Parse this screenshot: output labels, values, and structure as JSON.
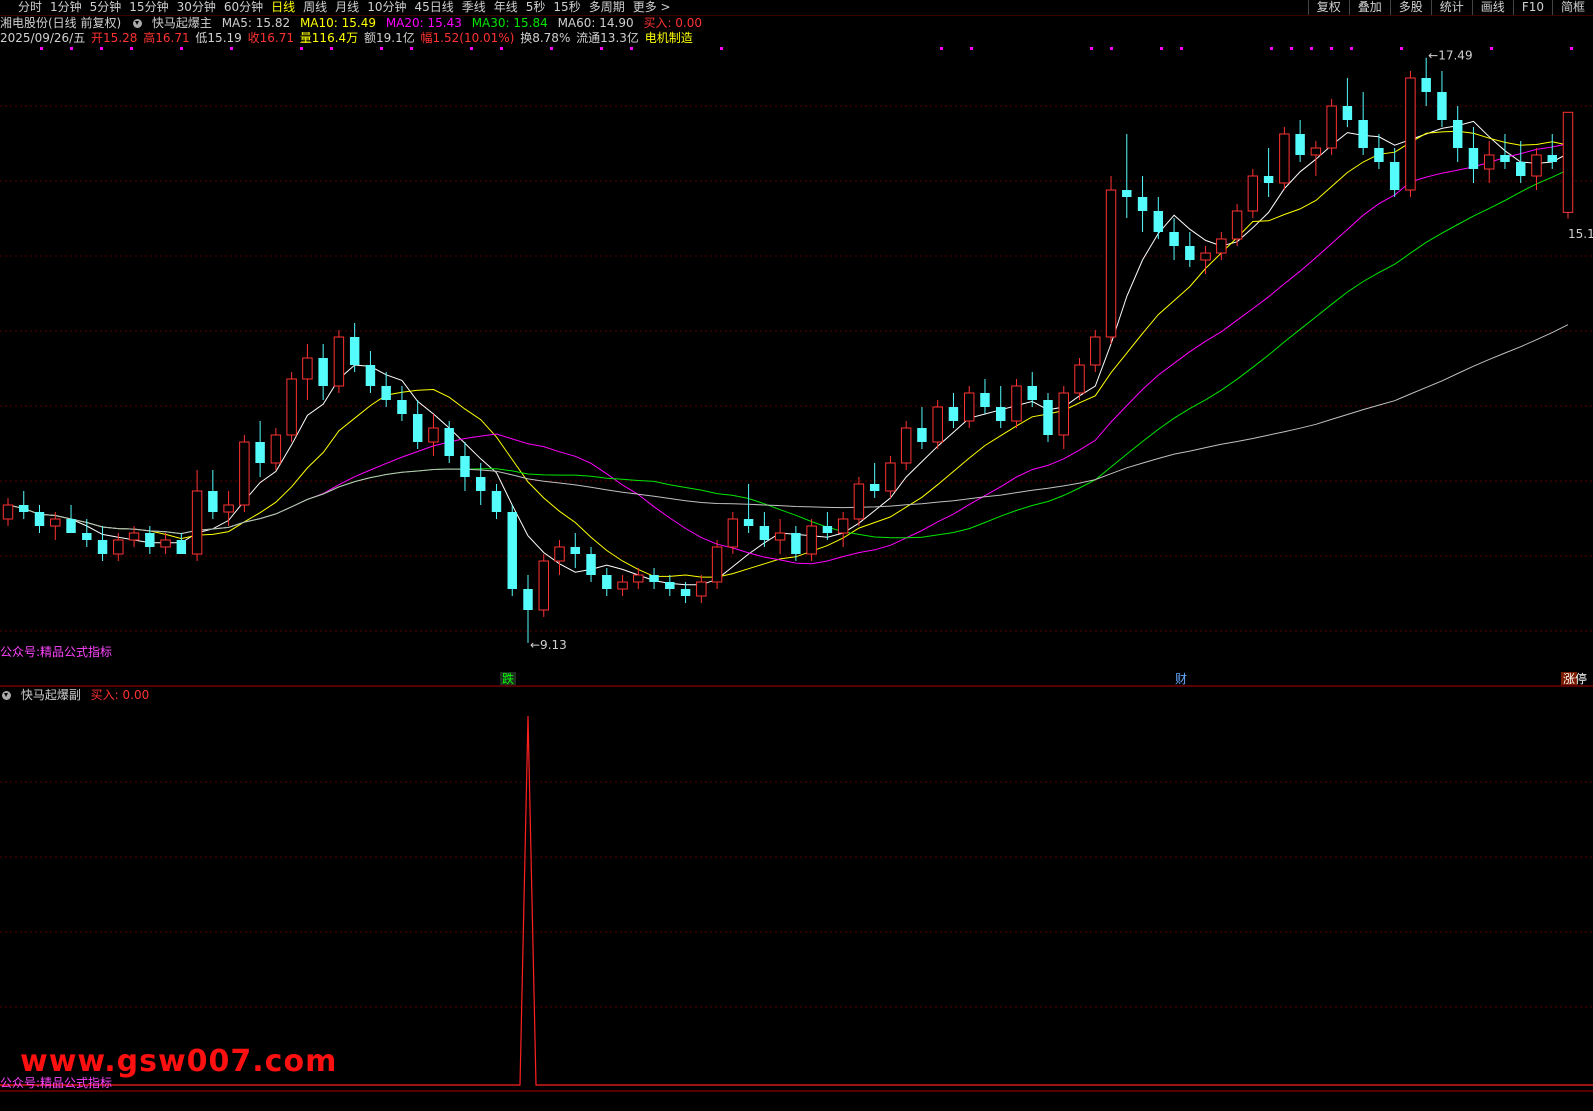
{
  "topbar": {
    "periods": [
      "分时",
      "1分钟",
      "5分钟",
      "15分钟",
      "30分钟",
      "60分钟",
      "日线",
      "周线",
      "月线",
      "10分钟",
      "45日线",
      "季线",
      "年线",
      "5秒",
      "15秒",
      "多周期",
      "更多 >"
    ],
    "active_period": "日线",
    "right_buttons": [
      "复权",
      "叠加",
      "多股",
      "统计",
      "画线",
      "F10",
      "简框"
    ]
  },
  "header": {
    "stock_name": "湘电股份(日线 前复权)",
    "indicator_name": "快马起爆主",
    "ma5": "MA5: 15.82",
    "ma10": "MA10: 15.49",
    "ma20": "MA20: 15.43",
    "ma30": "MA30: 15.84",
    "ma60": "MA60: 14.90",
    "buy": "买入: 0.00",
    "date": "2025/09/26/五",
    "open": "开15.28",
    "high": "高16.71",
    "low": "低15.19",
    "close": "收16.71",
    "volume": "量116.4万",
    "amount": "额19.1亿",
    "change": "幅1.52(10.01%)",
    "turnover": "换8.78%",
    "float": "流通13.3亿",
    "sector": "电机制造"
  },
  "chart_annotations": {
    "high_label": "17.49",
    "low_label": "9.13",
    "last_label": "15.1",
    "marker_die": "跌",
    "marker_cai": "财",
    "marker_zhangting": "涨停"
  },
  "sub_panel": {
    "title": "快马起爆副",
    "buy": "买入: 0.00"
  },
  "watermark": {
    "main": "公众号:精品公式指标",
    "sub": "公众号:精品公式指标",
    "site": "www.gsw007.com"
  },
  "colors": {
    "up": "#ff3232",
    "down": "#54fcfc",
    "ma5": "#ffffff",
    "ma10": "#ffff00",
    "ma20": "#ff00ff",
    "ma30": "#00e600",
    "ma60": "#c0c0c0"
  },
  "chart_data": {
    "type": "candlestick",
    "ohlc": [
      [
        10.9,
        11.2,
        10.8,
        11.1
      ],
      [
        11.1,
        11.3,
        10.9,
        11.0
      ],
      [
        11.0,
        11.1,
        10.7,
        10.8
      ],
      [
        10.8,
        11.0,
        10.6,
        10.9
      ],
      [
        10.9,
        11.1,
        10.7,
        10.7
      ],
      [
        10.7,
        10.9,
        10.5,
        10.6
      ],
      [
        10.6,
        10.8,
        10.3,
        10.4
      ],
      [
        10.4,
        10.7,
        10.3,
        10.6
      ],
      [
        10.6,
        10.8,
        10.5,
        10.7
      ],
      [
        10.7,
        10.8,
        10.4,
        10.5
      ],
      [
        10.5,
        10.7,
        10.4,
        10.6
      ],
      [
        10.6,
        10.7,
        10.4,
        10.4
      ],
      [
        10.4,
        11.6,
        10.3,
        11.3
      ],
      [
        11.3,
        11.6,
        10.9,
        11.0
      ],
      [
        11.0,
        11.3,
        10.8,
        11.1
      ],
      [
        11.1,
        12.1,
        11.0,
        12.0
      ],
      [
        12.0,
        12.3,
        11.5,
        11.7
      ],
      [
        11.7,
        12.2,
        11.6,
        12.1
      ],
      [
        12.1,
        13.0,
        12.0,
        12.9
      ],
      [
        12.9,
        13.4,
        12.6,
        13.2
      ],
      [
        13.2,
        13.4,
        12.6,
        12.8
      ],
      [
        12.8,
        13.6,
        12.7,
        13.5
      ],
      [
        13.5,
        13.7,
        13.0,
        13.1
      ],
      [
        13.1,
        13.3,
        12.7,
        12.8
      ],
      [
        12.8,
        13.0,
        12.5,
        12.6
      ],
      [
        12.6,
        12.8,
        12.3,
        12.4
      ],
      [
        12.4,
        12.6,
        11.9,
        12.0
      ],
      [
        12.0,
        12.4,
        11.8,
        12.2
      ],
      [
        12.2,
        12.3,
        11.7,
        11.8
      ],
      [
        11.8,
        12.0,
        11.3,
        11.5
      ],
      [
        11.5,
        11.7,
        11.1,
        11.3
      ],
      [
        11.3,
        11.4,
        10.9,
        11.0
      ],
      [
        11.0,
        11.1,
        9.8,
        9.9
      ],
      [
        9.9,
        10.1,
        9.13,
        9.6
      ],
      [
        9.6,
        10.4,
        9.5,
        10.3
      ],
      [
        10.3,
        10.6,
        10.1,
        10.5
      ],
      [
        10.5,
        10.7,
        10.2,
        10.4
      ],
      [
        10.4,
        10.5,
        10.0,
        10.1
      ],
      [
        10.1,
        10.2,
        9.8,
        9.9
      ],
      [
        9.9,
        10.1,
        9.8,
        10.0
      ],
      [
        10.0,
        10.2,
        9.9,
        10.1
      ],
      [
        10.1,
        10.2,
        9.9,
        10.0
      ],
      [
        10.0,
        10.1,
        9.8,
        9.9
      ],
      [
        9.9,
        10.0,
        9.7,
        9.8
      ],
      [
        9.8,
        10.1,
        9.7,
        10.0
      ],
      [
        10.0,
        10.6,
        9.9,
        10.5
      ],
      [
        10.5,
        11.0,
        10.4,
        10.9
      ],
      [
        10.9,
        11.4,
        10.7,
        10.8
      ],
      [
        10.8,
        11.0,
        10.5,
        10.6
      ],
      [
        10.6,
        10.9,
        10.4,
        10.7
      ],
      [
        10.7,
        10.8,
        10.3,
        10.4
      ],
      [
        10.4,
        10.9,
        10.3,
        10.8
      ],
      [
        10.8,
        11.0,
        10.6,
        10.7
      ],
      [
        10.7,
        11.0,
        10.5,
        10.9
      ],
      [
        10.9,
        11.5,
        10.8,
        11.4
      ],
      [
        11.4,
        11.7,
        11.2,
        11.3
      ],
      [
        11.3,
        11.8,
        11.2,
        11.7
      ],
      [
        11.7,
        12.3,
        11.6,
        12.2
      ],
      [
        12.2,
        12.5,
        11.9,
        12.0
      ],
      [
        12.0,
        12.6,
        11.9,
        12.5
      ],
      [
        12.5,
        12.7,
        12.2,
        12.3
      ],
      [
        12.3,
        12.8,
        12.2,
        12.7
      ],
      [
        12.7,
        12.9,
        12.4,
        12.5
      ],
      [
        12.5,
        12.8,
        12.2,
        12.3
      ],
      [
        12.3,
        12.9,
        12.2,
        12.8
      ],
      [
        12.8,
        13.0,
        12.5,
        12.6
      ],
      [
        12.6,
        12.7,
        12.0,
        12.1
      ],
      [
        12.1,
        12.8,
        11.9,
        12.7
      ],
      [
        12.7,
        13.2,
        12.6,
        13.1
      ],
      [
        13.1,
        13.6,
        13.0,
        13.5
      ],
      [
        13.5,
        15.8,
        13.4,
        15.6
      ],
      [
        15.6,
        16.4,
        15.2,
        15.5
      ],
      [
        15.5,
        15.8,
        15.0,
        15.3
      ],
      [
        15.3,
        15.5,
        14.9,
        15.0
      ],
      [
        15.0,
        15.2,
        14.6,
        14.8
      ],
      [
        14.8,
        15.0,
        14.5,
        14.6
      ],
      [
        14.6,
        14.8,
        14.4,
        14.7
      ],
      [
        14.7,
        15.0,
        14.6,
        14.9
      ],
      [
        14.9,
        15.4,
        14.8,
        15.3
      ],
      [
        15.3,
        15.9,
        15.2,
        15.8
      ],
      [
        15.8,
        16.2,
        15.5,
        15.7
      ],
      [
        15.7,
        16.5,
        15.6,
        16.4
      ],
      [
        16.4,
        16.6,
        16.0,
        16.1
      ],
      [
        16.1,
        16.3,
        15.8,
        16.2
      ],
      [
        16.2,
        16.9,
        16.1,
        16.8
      ],
      [
        16.8,
        17.2,
        16.5,
        16.6
      ],
      [
        16.6,
        17.0,
        16.1,
        16.2
      ],
      [
        16.2,
        16.4,
        15.9,
        16.0
      ],
      [
        16.0,
        16.2,
        15.5,
        15.6
      ],
      [
        15.6,
        17.3,
        15.5,
        17.2
      ],
      [
        17.2,
        17.49,
        16.8,
        17.0
      ],
      [
        17.0,
        17.3,
        16.5,
        16.6
      ],
      [
        16.6,
        16.8,
        16.0,
        16.2
      ],
      [
        16.2,
        16.5,
        15.7,
        15.9
      ],
      [
        15.9,
        16.3,
        15.7,
        16.1
      ],
      [
        16.1,
        16.4,
        15.9,
        16.0
      ],
      [
        16.0,
        16.3,
        15.7,
        15.8
      ],
      [
        15.8,
        16.2,
        15.6,
        16.1
      ],
      [
        16.1,
        16.4,
        15.9,
        16.0
      ],
      [
        15.28,
        16.71,
        15.19,
        16.71
      ]
    ],
    "sub_signal_peak_index": 33,
    "ylim": [
      9.0,
      17.6
    ]
  }
}
